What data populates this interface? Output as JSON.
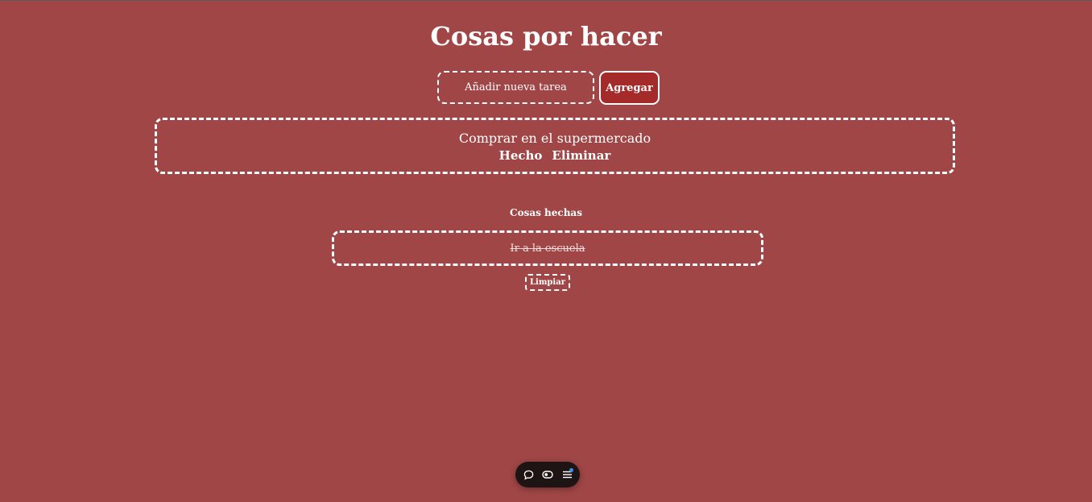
{
  "header": {
    "title": "Cosas por hacer"
  },
  "add_task": {
    "placeholder": "Añadir nueva tarea",
    "button_label": "Agregar"
  },
  "todos": [
    {
      "text": "Comprar en el supermercado",
      "done_label": "Hecho",
      "delete_label": "Eliminar"
    }
  ],
  "done_section": {
    "heading": "Cosas hechas",
    "items": [
      {
        "text": "Ir a la escuela"
      }
    ],
    "clear_label": "Limpiar"
  },
  "toolbar": {
    "icons": [
      "comment-icon",
      "toggle-icon",
      "menu-icon"
    ],
    "notification_color": "#3b8df0"
  },
  "colors": {
    "background": "#a04646",
    "button_background": "#a52a2a",
    "toolbar_background": "#1f1414"
  }
}
